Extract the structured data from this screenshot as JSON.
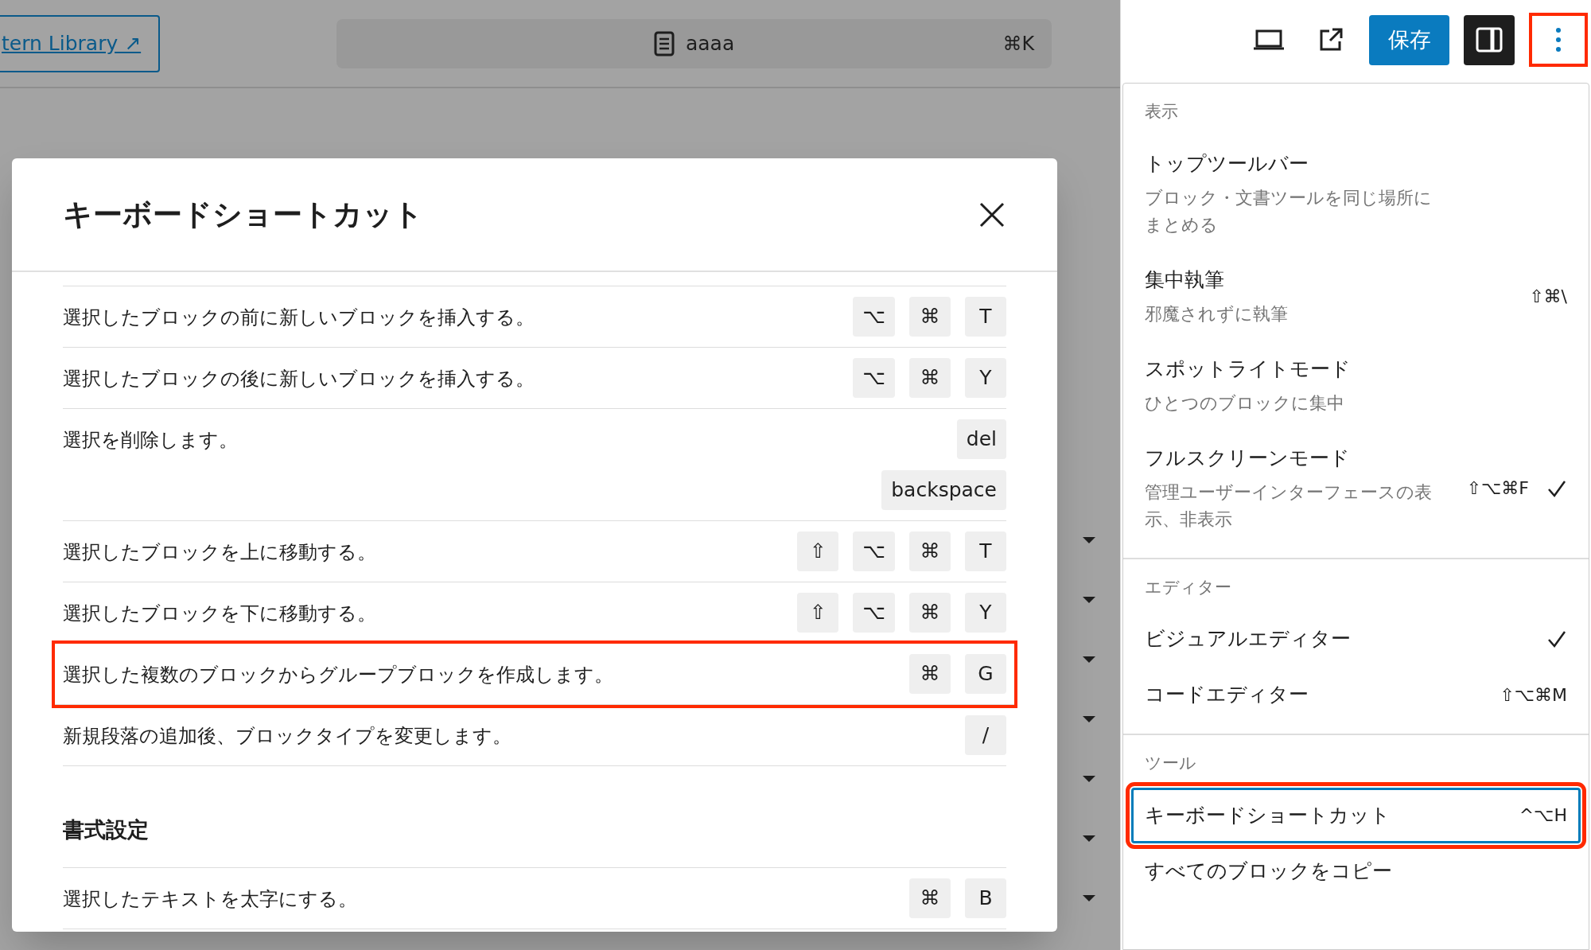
{
  "top_bar": {
    "pattern_link": "tern Library ↗",
    "command_bar": {
      "title": "aaaa",
      "shortcut": "⌘K"
    }
  },
  "toolbar": {
    "save_button": "保存",
    "sidebar_toggle": {
      "on": true
    },
    "options_button": {
      "highlighted": true
    }
  },
  "menu": {
    "sections": [
      {
        "title": "表示",
        "items": [
          {
            "label": "トップツールバー",
            "description": "ブロック・文書ツールを同じ場所にまとめる",
            "checked": false,
            "highlighted": false
          },
          {
            "label": "集中執筆",
            "description": "邪魔されずに執筆",
            "shortcut": "⇧⌘\\",
            "checked": false,
            "highlighted": false
          },
          {
            "label": "スポットライトモード",
            "description": "ひとつのブロックに集中",
            "checked": false,
            "highlighted": false
          },
          {
            "label": "フルスクリーンモード",
            "description": "管理ユーザーインターフェースの表示、非表示",
            "shortcut": "⇧⌥⌘F",
            "checked": true,
            "highlighted": false
          }
        ]
      },
      {
        "title": "エディター",
        "items": [
          {
            "label": "ビジュアルエディター",
            "checked": true,
            "highlighted": false
          },
          {
            "label": "コードエディター",
            "shortcut": "⇧⌥⌘M",
            "checked": false,
            "highlighted": false
          }
        ]
      },
      {
        "title": "ツール",
        "items": [
          {
            "label": "キーボードショートカット",
            "shortcut": "^⌥H",
            "checked": false,
            "highlighted": true
          },
          {
            "label": "すべてのブロックをコピー",
            "checked": false,
            "highlighted": false
          }
        ]
      }
    ]
  },
  "modal": {
    "title": "キーボードショートカット",
    "sections": [
      {
        "rows": [
          {
            "text": "選択したブロックの前に新しいブロックを挿入する。",
            "combos": [
              [
                "⌥",
                "⌘",
                "T"
              ]
            ],
            "highlighted": false
          },
          {
            "text": "選択したブロックの後に新しいブロックを挿入する。",
            "combos": [
              [
                "⌥",
                "⌘",
                "Y"
              ]
            ],
            "highlighted": false
          },
          {
            "text": "選択を削除します。",
            "combos": [
              [
                "del"
              ],
              [
                "backspace"
              ]
            ],
            "highlighted": false
          },
          {
            "text": "選択したブロックを上に移動する。",
            "combos": [
              [
                "⇧",
                "⌥",
                "⌘",
                "T"
              ]
            ],
            "highlighted": false
          },
          {
            "text": "選択したブロックを下に移動する。",
            "combos": [
              [
                "⇧",
                "⌥",
                "⌘",
                "Y"
              ]
            ],
            "highlighted": false
          },
          {
            "text": "選択した複数のブロックからグループブロックを作成します。",
            "combos": [
              [
                "⌘",
                "G"
              ]
            ],
            "highlighted": true
          },
          {
            "text": "新規段落の追加後、ブロックタイプを変更します。",
            "combos": [
              [
                "/"
              ]
            ],
            "highlighted": false
          }
        ]
      },
      {
        "title": "書式設定",
        "rows": [
          {
            "text": "選択したテキストを太字にする。",
            "combos": [
              [
                "⌘",
                "B"
              ]
            ],
            "highlighted": false
          }
        ]
      }
    ]
  }
}
